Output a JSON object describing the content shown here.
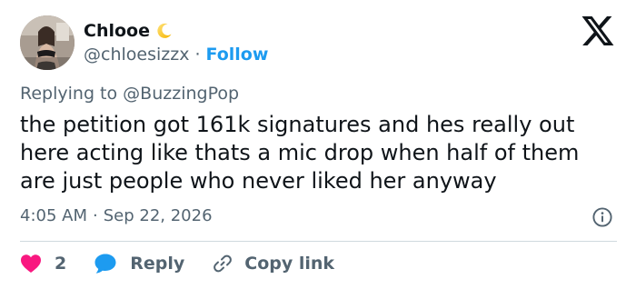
{
  "author": {
    "display_name": "Chlooe",
    "name_emoji_icon": "crescent-moon-icon",
    "handle": "@chloesizzx",
    "separator": "·",
    "follow_label": "Follow"
  },
  "platform": {
    "logo_icon": "x-logo-icon"
  },
  "reply_context": {
    "prefix": "Replying to",
    "target": "@BuzzingPop"
  },
  "tweet": {
    "lines": [
      "the petition got 161k signatures and hes really out",
      "here acting like thats a mic drop when half of them",
      "are just people who never liked her anyway"
    ]
  },
  "meta": {
    "time": "4:05 AM",
    "separator": "·",
    "date": "Sep 22, 2026",
    "info_icon": "info-icon"
  },
  "actions": {
    "like_count": "2",
    "reply_label": "Reply",
    "copy_link_label": "Copy link"
  },
  "colors": {
    "accent": "#1d9bf0",
    "like": "#f91880",
    "text_primary": "#0f1419",
    "text_secondary": "#536471",
    "divider": "#cfd9de"
  }
}
